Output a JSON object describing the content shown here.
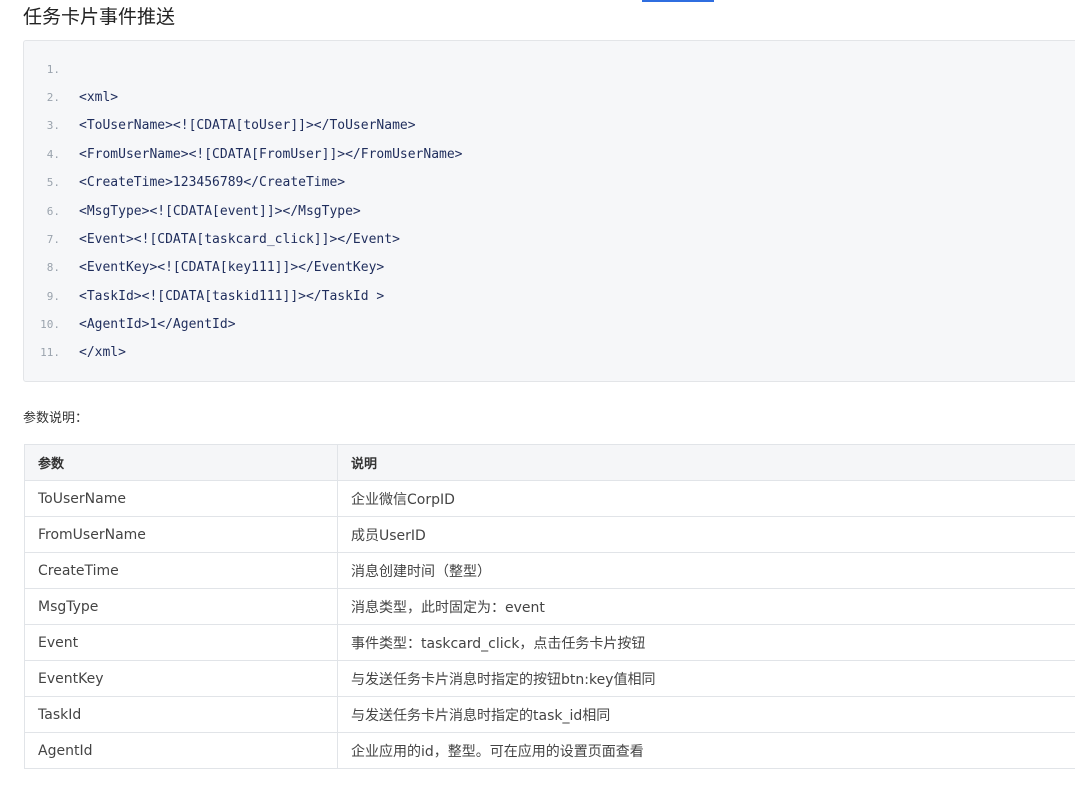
{
  "heading": "任务卡片事件推送",
  "code": {
    "lines": [
      {
        "num": "1.",
        "text": ""
      },
      {
        "num": "2.",
        "text": "<xml>"
      },
      {
        "num": "3.",
        "text": "<ToUserName><![CDATA[toUser]]></ToUserName>"
      },
      {
        "num": "4.",
        "text": "<FromUserName><![CDATA[FromUser]]></FromUserName>"
      },
      {
        "num": "5.",
        "text": "<CreateTime>123456789</CreateTime>"
      },
      {
        "num": "6.",
        "text": "<MsgType><![CDATA[event]]></MsgType>"
      },
      {
        "num": "7.",
        "text": "<Event><![CDATA[taskcard_click]]></Event>"
      },
      {
        "num": "8.",
        "text": "<EventKey><![CDATA[key111]]></EventKey>"
      },
      {
        "num": "9.",
        "text": "<TaskId><![CDATA[taskid111]]></TaskId >"
      },
      {
        "num": "10.",
        "text": "<AgentId>1</AgentId>"
      },
      {
        "num": "11.",
        "text": "</xml>"
      }
    ]
  },
  "params": {
    "label": "参数说明：",
    "headers": {
      "param": "参数",
      "desc": "说明"
    },
    "rows": [
      {
        "param": "ToUserName",
        "desc": "企业微信CorpID"
      },
      {
        "param": "FromUserName",
        "desc": "成员UserID"
      },
      {
        "param": "CreateTime",
        "desc": "消息创建时间（整型）"
      },
      {
        "param": "MsgType",
        "desc": "消息类型，此时固定为：event"
      },
      {
        "param": "Event",
        "desc": "事件类型：taskcard_click，点击任务卡片按钮"
      },
      {
        "param": "EventKey",
        "desc": "与发送任务卡片消息时指定的按钮btn:key值相同"
      },
      {
        "param": "TaskId",
        "desc": "与发送任务卡片消息时指定的task_id相同"
      },
      {
        "param": "AgentId",
        "desc": "企业应用的id，整型。可在应用的设置页面查看"
      }
    ]
  }
}
